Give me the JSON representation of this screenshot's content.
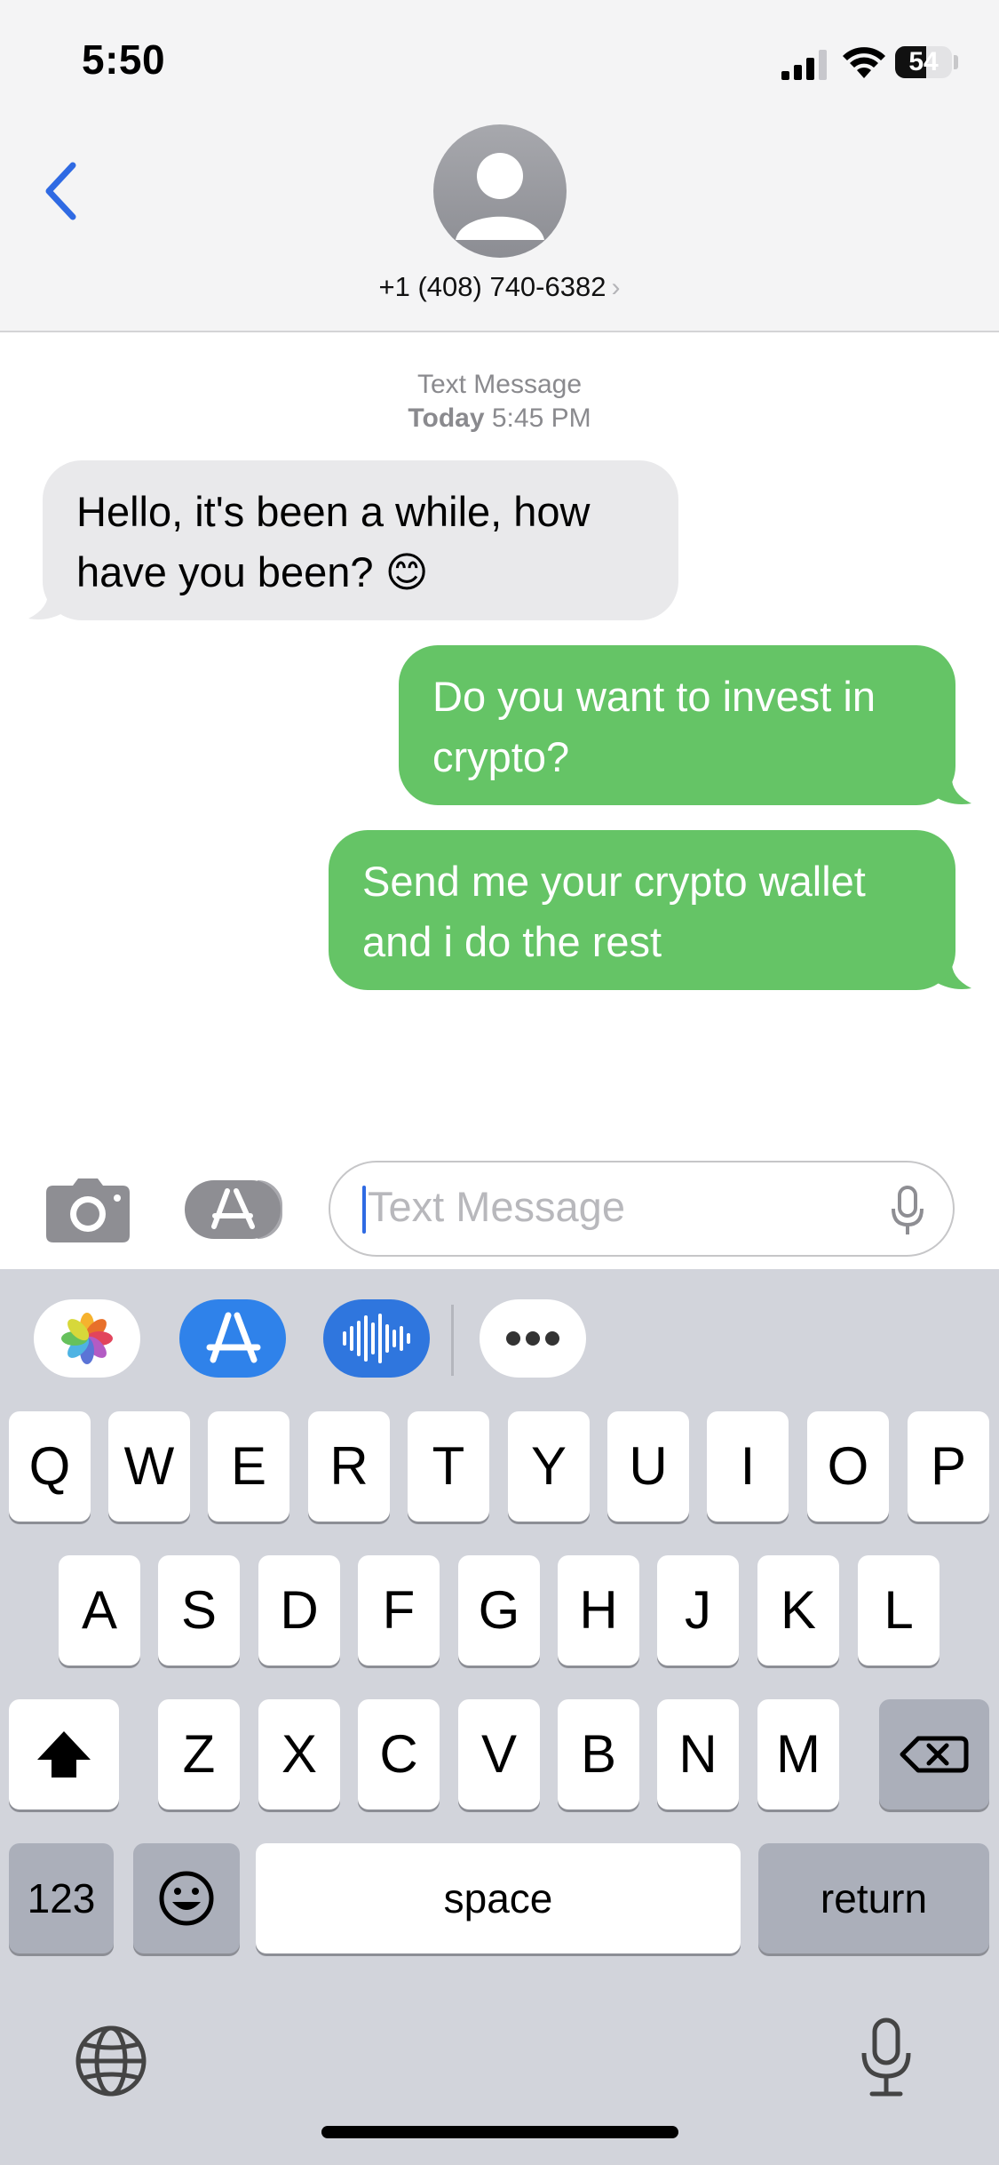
{
  "status_bar": {
    "time": "5:50",
    "battery_percent": "54",
    "battery_level": 0.54
  },
  "header": {
    "contact": "+1 (408) 740-6382",
    "chevron": "›",
    "back_icon": "chevron-left-icon",
    "avatar_icon": "person-icon"
  },
  "conversation": {
    "service_label": "Text Message",
    "day_label": "Today",
    "time_label": "5:45 PM",
    "messages": [
      {
        "direction": "incoming",
        "lines": [
          "Hello, it's been a while, how",
          "have you been? 😊"
        ]
      },
      {
        "direction": "outgoing",
        "lines": [
          "Do you want to invest in",
          "crypto?"
        ]
      },
      {
        "direction": "outgoing",
        "lines": [
          "Send me your crypto wallet",
          "and i do the rest"
        ]
      }
    ]
  },
  "input_bar": {
    "placeholder": "Text Message",
    "camera_icon": "camera-icon",
    "apps_icon": "app-store-icon",
    "mic_icon": "microphone-icon"
  },
  "app_strip": [
    "photos-icon",
    "app-store-icon",
    "audio-message-icon",
    "more-icon"
  ],
  "keyboard": {
    "row1": [
      "Q",
      "W",
      "E",
      "R",
      "T",
      "Y",
      "U",
      "I",
      "O",
      "P"
    ],
    "row2": [
      "A",
      "S",
      "D",
      "F",
      "G",
      "H",
      "J",
      "K",
      "L"
    ],
    "row3": [
      "Z",
      "X",
      "C",
      "V",
      "B",
      "N",
      "M"
    ],
    "numbers_key": "123",
    "space_key": "space",
    "return_key": "return",
    "shift_icon": "shift-icon",
    "delete_icon": "delete-icon",
    "emoji_icon": "emoji-icon",
    "globe_icon": "globe-icon",
    "dictation_icon": "microphone-icon"
  },
  "colors": {
    "accent": "#2f6ae3",
    "outgoing_bubble": "#65c466",
    "incoming_bubble": "#e9e9eb",
    "keyboard_bg": "#d2d4db"
  }
}
